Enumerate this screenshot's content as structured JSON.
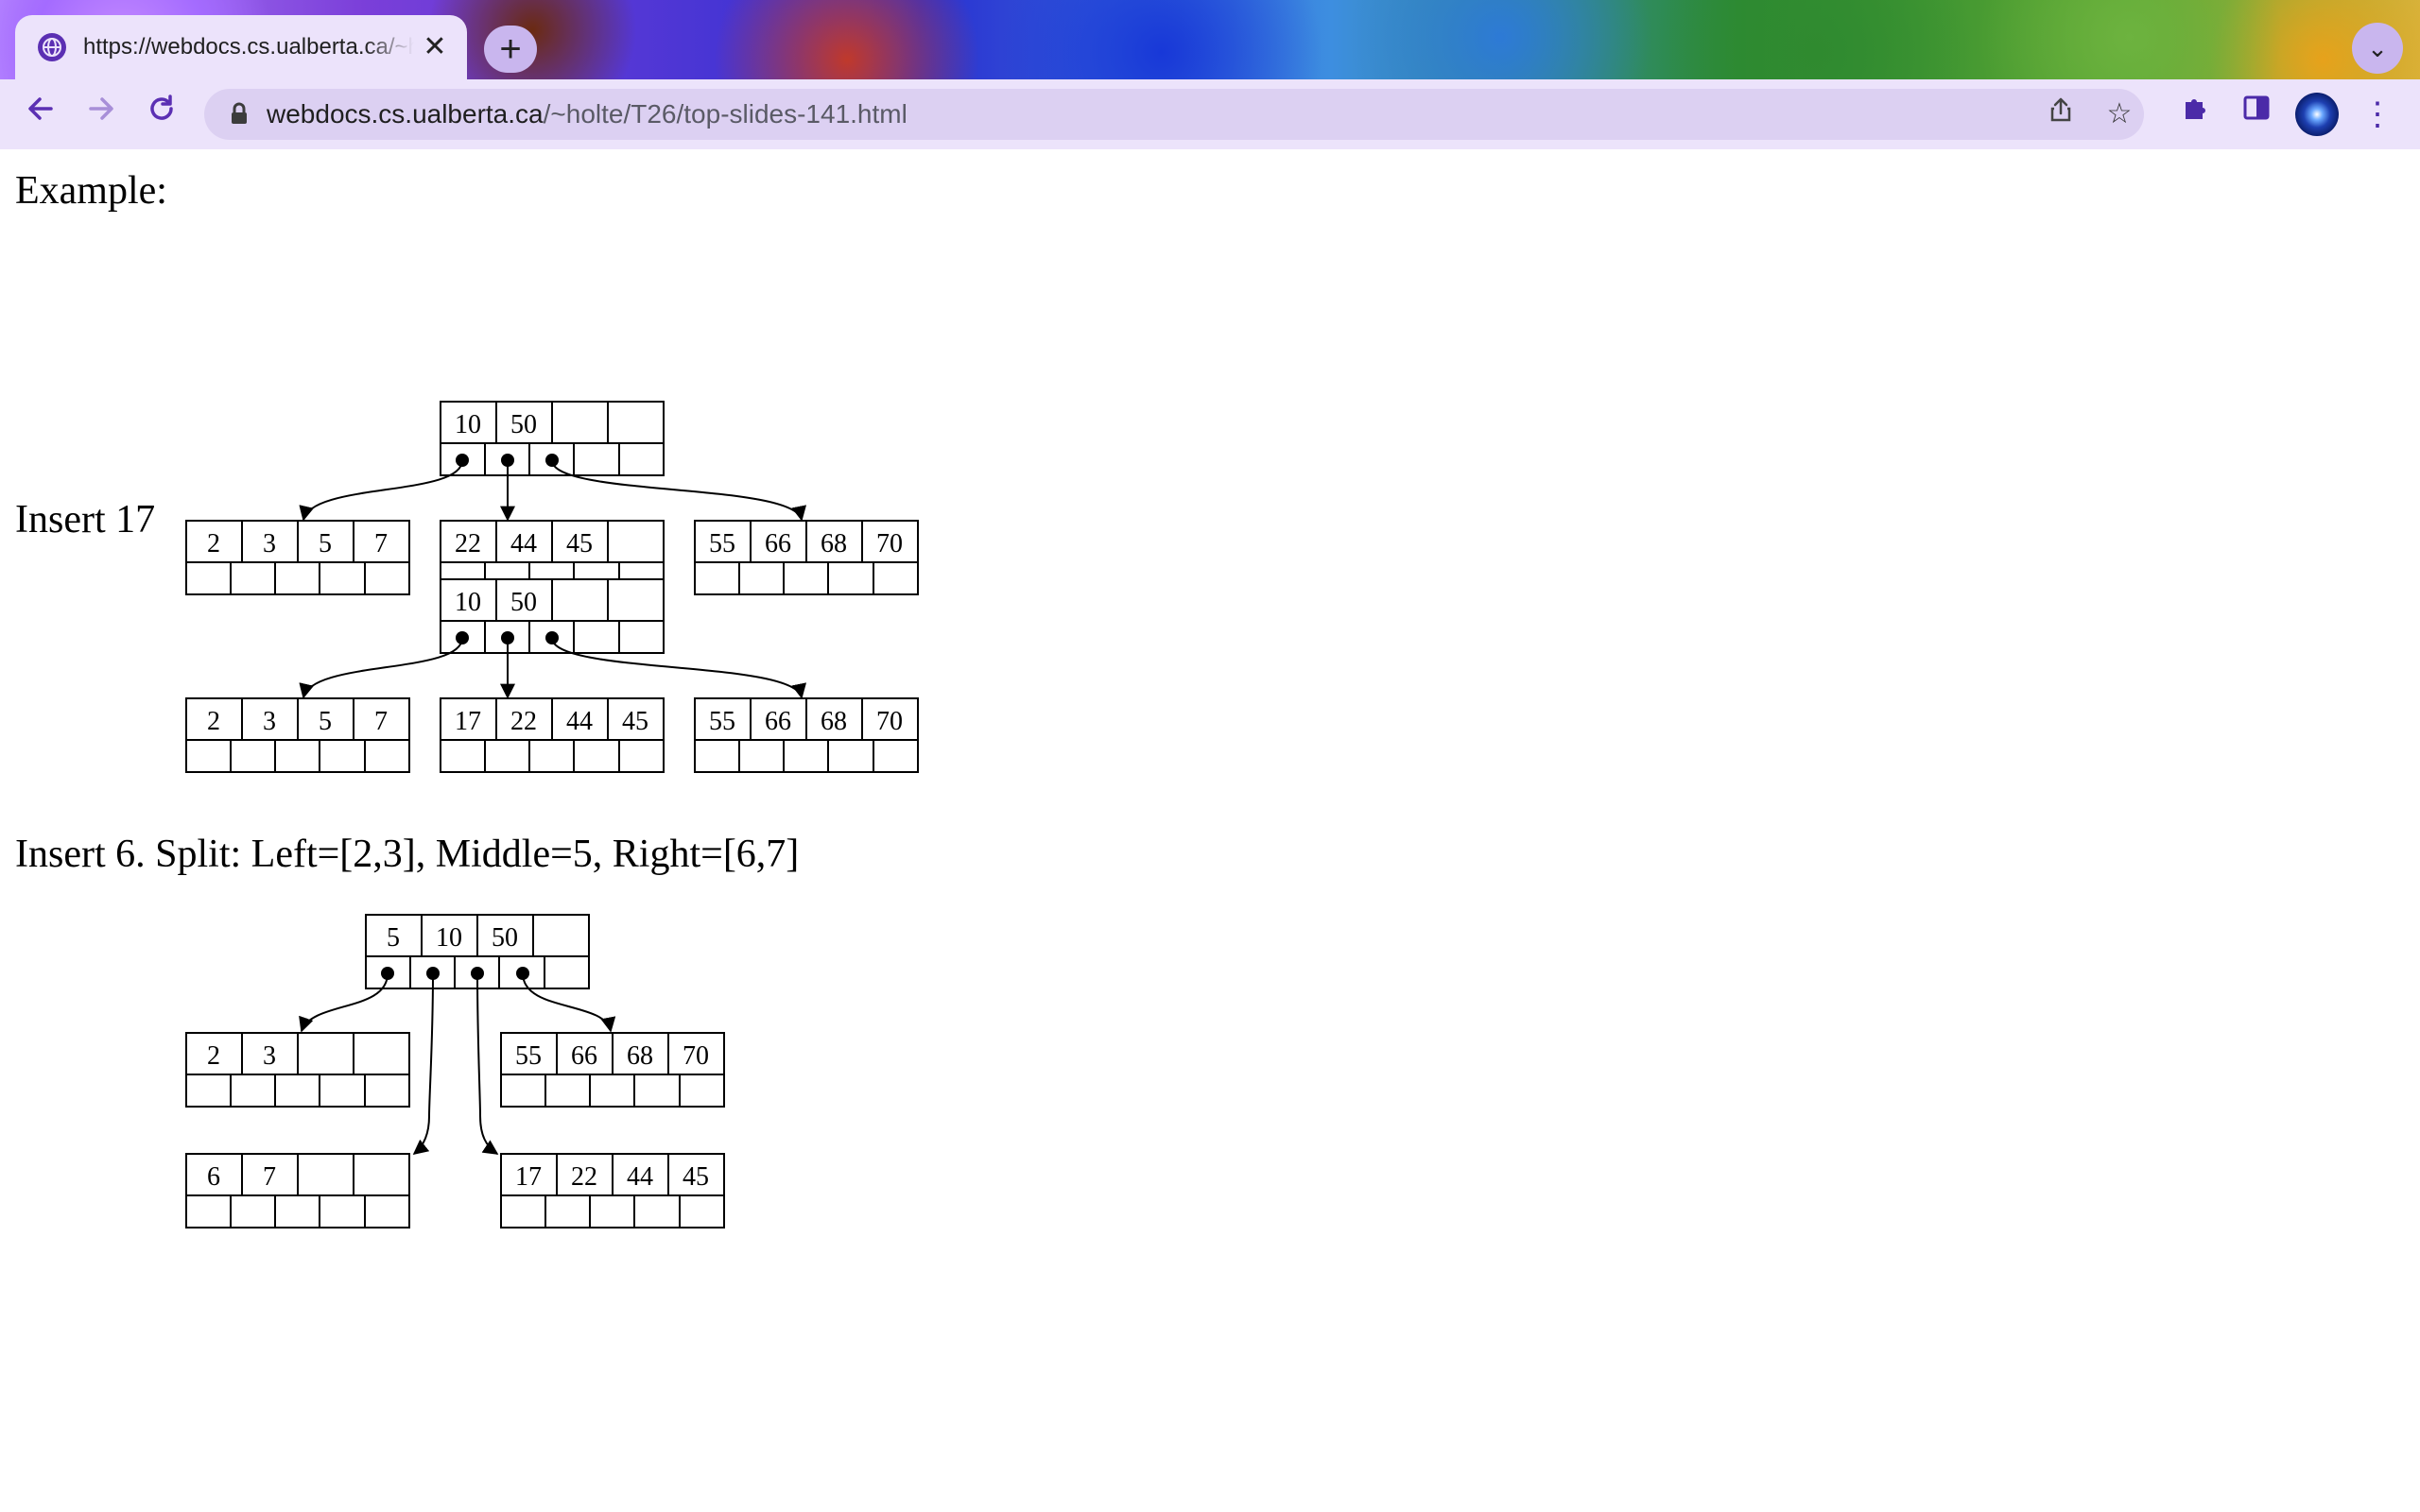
{
  "browser": {
    "tab_title": "https://webdocs.cs.ualberta.ca/~holte/T26/top-slides-141.html",
    "url_host": "webdocs.cs.ualberta.ca",
    "url_path": "/~holte/T26/top-slides-141.html",
    "icons": {
      "back": "arrow-left-icon",
      "forward": "arrow-right-icon",
      "reload": "reload-icon",
      "lock": "lock-icon",
      "share": "share-icon",
      "bookmark": "star-icon",
      "extensions": "puzzle-icon",
      "side_panel": "side-panel-icon",
      "menu": "kebab-menu-icon"
    },
    "accent_color": "#5b2fb3"
  },
  "page": {
    "sections": [
      {
        "heading": "Example:",
        "root": {
          "keys": [
            "10",
            "50",
            "",
            ""
          ],
          "pointers": [
            true,
            true,
            true,
            false,
            false
          ]
        },
        "leaves": [
          {
            "keys": [
              "2",
              "3",
              "5",
              "7"
            ]
          },
          {
            "keys": [
              "22",
              "44",
              "45",
              ""
            ]
          },
          {
            "keys": [
              "55",
              "66",
              "68",
              "70"
            ]
          }
        ]
      },
      {
        "heading": "Insert 17",
        "root": {
          "keys": [
            "10",
            "50",
            "",
            ""
          ],
          "pointers": [
            true,
            true,
            true,
            false,
            false
          ]
        },
        "leaves": [
          {
            "keys": [
              "2",
              "3",
              "5",
              "7"
            ]
          },
          {
            "keys": [
              "17",
              "22",
              "44",
              "45"
            ]
          },
          {
            "keys": [
              "55",
              "66",
              "68",
              "70"
            ]
          }
        ]
      },
      {
        "heading": "Insert 6. Split: Left=[2,3], Middle=5, Right=[6,7]",
        "root": {
          "keys": [
            "5",
            "10",
            "50",
            ""
          ],
          "pointers": [
            true,
            true,
            true,
            true,
            false
          ]
        },
        "leaves": [
          {
            "keys": [
              "2",
              "3",
              "",
              ""
            ]
          },
          {
            "keys": [
              "55",
              "66",
              "68",
              "70"
            ]
          },
          {
            "keys": [
              "6",
              "7",
              "",
              ""
            ]
          },
          {
            "keys": [
              "17",
              "22",
              "44",
              "45"
            ]
          }
        ]
      }
    ]
  }
}
